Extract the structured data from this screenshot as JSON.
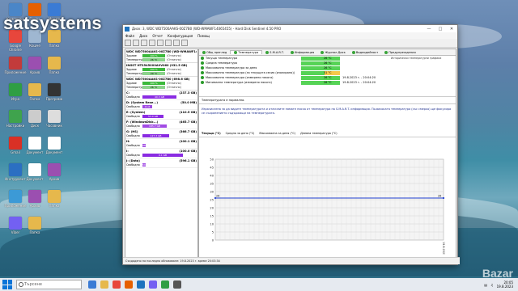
{
  "watermark": "satsystems",
  "watermark_corner": "Bazar",
  "desktop_icons": [
    {
      "label": "Компютър",
      "color": "#4a86c8"
    },
    {
      "label": "Firefox",
      "color": "#e66000"
    },
    {
      "label": "Мрежа",
      "color": "#3a7bd5"
    },
    {
      "label": "Google Chrome",
      "color": "#e8463c"
    },
    {
      "label": "Кошче",
      "color": "#9fb7d1"
    },
    {
      "label": "Папка",
      "color": "#e6b84c"
    },
    {
      "label": "Приложение",
      "color": "#c23b3b"
    },
    {
      "label": "Архив",
      "color": "#9b4fb0"
    },
    {
      "label": "Папка",
      "color": "#e6b84c"
    },
    {
      "label": "Игра",
      "color": "#2f9e44"
    },
    {
      "label": "Папка",
      "color": "#e6b84c"
    },
    {
      "label": "Програма",
      "color": "#333333"
    },
    {
      "label": "Настройки",
      "color": "#3fa34d"
    },
    {
      "label": "Диск",
      "color": "#cccccc"
    },
    {
      "label": "Часовник",
      "color": "#dddddd"
    },
    {
      "label": "Gmail",
      "color": "#d93025"
    },
    {
      "label": "Документ",
      "color": "#ffffff"
    },
    {
      "label": "Документ",
      "color": "#ffffff"
    },
    {
      "label": "Инструмент",
      "color": "#2b6fc2"
    },
    {
      "label": "Документ",
      "color": "#ffffff"
    },
    {
      "label": "Архив",
      "color": "#9b4fb0"
    },
    {
      "label": "Приложение",
      "color": "#3c9ad6"
    },
    {
      "label": "Архив",
      "color": "#9b4fb0"
    },
    {
      "label": "Папка",
      "color": "#e6b84c"
    },
    {
      "label": "Viber",
      "color": "#7360f2"
    },
    {
      "label": "Папка",
      "color": "#e6b84c"
    }
  ],
  "window": {
    "title": "Диск: 3, WDC WD7500AAKS-00Z7B0 (WD-WMAWF14065455) - Hard Disk Sentinel 4.50 PRO",
    "menu": [
      "Файл",
      "Диск",
      "Отчет",
      "Конфигурация",
      "Помощ"
    ],
    "status_bar": "Създадено на последно обновяване: 19.8.2023 г. време 20:03:34"
  },
  "disks": [
    {
      "name": "WDC WD7500AAKS-00Z7B0 (WD-WMAWF14065455)",
      "health_label": "Здраве",
      "health": "100 %",
      "health_note": "(Отлично)",
      "temp_label": "Температура",
      "temp": "26 °C",
      "temp_note": "(Отлично)"
    },
    {
      "name": "INGST HTS5450X0A9V060 (931.5 GB)",
      "health_label": "Здраве",
      "health": "100 %",
      "health_note": "(Отлично)",
      "temp_label": "Температура",
      "temp": "29 °C",
      "temp_note": "(Отлично)"
    },
    {
      "name": "WDC WD7500AAKS-00Z7B0 (698.6 GB)",
      "health_label": "Здраве",
      "health": "100 %",
      "health_note": "(Отлично)",
      "temp_label": "Температура",
      "temp": "26 °C",
      "temp_note": "(Отлично)"
    }
  ],
  "volumes": [
    {
      "name": "C:",
      "size": "(237.3 GB)",
      "free_label": "Свободно",
      "free": "40.3 GB",
      "free_pct": 0.83
    },
    {
      "name": "D: (System Rese...)",
      "size": "(50.0 MB)",
      "free_label": "Свободно",
      "free": "11.6 MB",
      "free_pct": 0.23
    },
    {
      "name": "E: (System)",
      "size": "(110.5 GB)",
      "free_label": "Свободно",
      "free": "53.0 GB",
      "free_pct": 0.52
    },
    {
      "name": "F: (WindowsDisk...)",
      "size": "(465.7 GB)",
      "free_label": "Свободно",
      "free": "185.7 GB",
      "free_pct": 0.6
    },
    {
      "name": "G: (HS)",
      "size": "(366.7 GB)",
      "free_label": "Свободно",
      "free": "127.3 GB",
      "free_pct": 0.65
    },
    {
      "name": "H:",
      "size": "(100.1 GB)",
      "free_label": "Свободно",
      "free": "98.4 GB",
      "free_pct": 0.02
    },
    {
      "name": "I:",
      "size": "(100.0 GB)",
      "free_label": "Свободно",
      "free": "0.1 GB",
      "free_pct": 0.99
    },
    {
      "name": "J: (Data)",
      "size": "(596.1 GB)",
      "free_label": "Свободно",
      "free": "590.5 GB",
      "free_pct": 0.01
    }
  ],
  "tabs": [
    "Общ преглед",
    "Температура",
    "S.M.A.R.T.",
    "Информация",
    "Журнал Диск",
    "Видеодейност",
    "Предупреждения"
  ],
  "temps": [
    {
      "label": "Текуща температура",
      "value": "26 °C",
      "status": "",
      "desc": "Исторически температурни графики"
    },
    {
      "label": "Средна температура",
      "value": "26 °C",
      "status": "",
      "desc": ""
    },
    {
      "label": "Максимална температура за деня",
      "value": "26 °C",
      "status": "",
      "desc": ""
    },
    {
      "label": "Максимална температура (за текущата сесия (изолирано))",
      "value": "51 °C",
      "status": "",
      "desc": ""
    },
    {
      "label": "Максимална температура (измерено някога)",
      "value": "26 °C",
      "status": "19.8.2023 г. - 20:04:20",
      "desc": ""
    },
    {
      "label": "Минимална температура (измерено някога)",
      "value": "26 °C",
      "status": "19.8.2023 г. - 20:04:20",
      "desc": ""
    }
  ],
  "temp_status": "Температурата е нормална.",
  "info_text": "Израчислена за да видите температурата и отличните нямате ниска от температура на S.M.A.R.T. информация. По-високата температура (със смерко) ще фокусира се съхранението съдържащи на температурата.",
  "chart_tabs": [
    "Текуща (°C)",
    "Средна за деня (°C)",
    "Максимална за деня (°C)",
    "Дневна температура (°C)"
  ],
  "chart_data": {
    "type": "line",
    "x": [
      "19.8.2023"
    ],
    "series": [
      {
        "values": [
          26
        ]
      }
    ],
    "ylim": [
      0,
      50
    ],
    "yticks": [
      0,
      5,
      10,
      15,
      20,
      25,
      30,
      35,
      40,
      45,
      50
    ],
    "point_label": "26",
    "grid": true
  },
  "taskbar": {
    "search_placeholder": "Търсене",
    "time": "20:05",
    "date": "19.8.2023"
  }
}
